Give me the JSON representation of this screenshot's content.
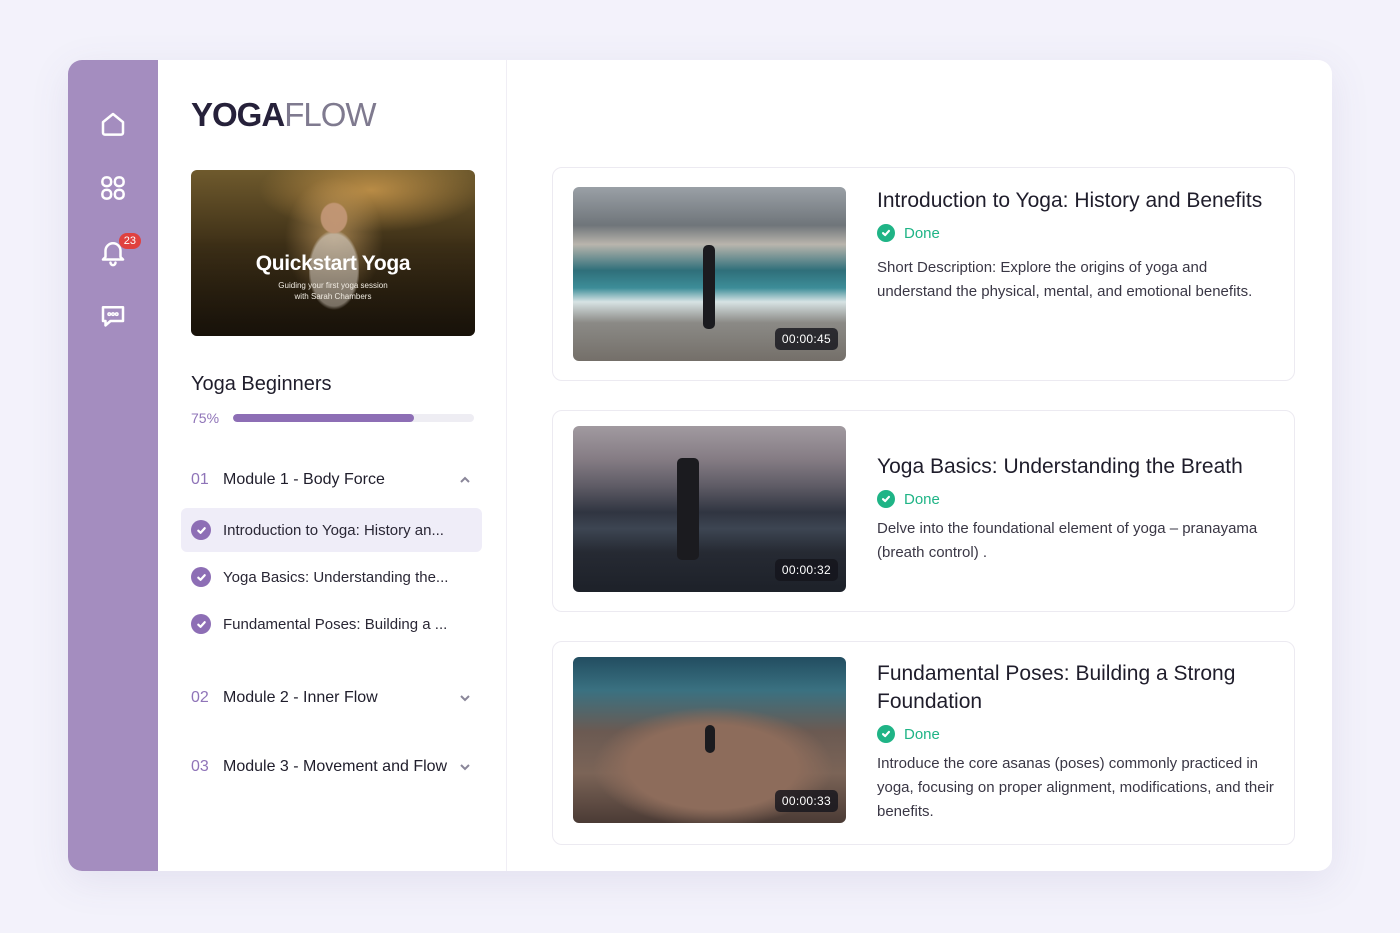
{
  "app": {
    "logo_bold": "YOGA",
    "logo_light": "FLOW"
  },
  "rail": {
    "items": [
      {
        "icon": "home-icon"
      },
      {
        "icon": "grid-icon"
      },
      {
        "icon": "bell-icon",
        "badge": "23"
      },
      {
        "icon": "chat-icon"
      }
    ]
  },
  "hero": {
    "title": "Quickstart Yoga",
    "subtitle_line1": "Guiding your first yoga session",
    "subtitle_line2": "with Sarah Chambers"
  },
  "course": {
    "title": "Yoga Beginners",
    "progress_label": "75%",
    "progress_value": 0.75
  },
  "modules": [
    {
      "num": "01",
      "name": "Module 1 - Body Force",
      "expanded": true,
      "lessons": [
        {
          "name": "Introduction to Yoga: History an...",
          "active": true
        },
        {
          "name": "Yoga Basics: Understanding the...",
          "active": false
        },
        {
          "name": "Fundamental Poses: Building a ...",
          "active": false
        }
      ]
    },
    {
      "num": "02",
      "name": "Module 2 - Inner Flow",
      "expanded": false
    },
    {
      "num": "03",
      "name": "Module 3 - Movement and Flow",
      "expanded": false
    }
  ],
  "videos": [
    {
      "title": "Introduction to Yoga: History and Benefits",
      "status": "Done",
      "duration": "00:00:45",
      "description": "Short Description: Explore the origins of yoga and understand the physical, mental, and emotional benefits."
    },
    {
      "title": "Yoga Basics: Understanding the Breath",
      "status": "Done",
      "duration": "00:00:32",
      "description": "Delve into the foundational element of yoga – pranayama (breath control) ."
    },
    {
      "title": "Fundamental Poses: Building a Strong Foundation",
      "status": "Done",
      "duration": "00:00:33",
      "description": "Introduce the core asanas (poses) commonly practiced in yoga, focusing on proper alignment, modifications, and their benefits."
    }
  ],
  "colors": {
    "rail": "#a48dbf",
    "accent": "#8d6eb5",
    "done": "#1fb486",
    "badge": "#e0413f"
  }
}
